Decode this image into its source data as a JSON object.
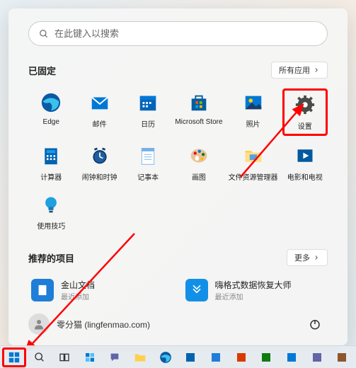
{
  "search": {
    "placeholder": "在此键入以搜索"
  },
  "pinned": {
    "title": "已固定",
    "all_btn": "所有应用",
    "apps": [
      {
        "label": "Edge"
      },
      {
        "label": "邮件"
      },
      {
        "label": "日历"
      },
      {
        "label": "Microsoft Store"
      },
      {
        "label": "照片"
      },
      {
        "label": "设置"
      },
      {
        "label": "计算器"
      },
      {
        "label": "闹钟和时钟"
      },
      {
        "label": "记事本"
      },
      {
        "label": "画图"
      },
      {
        "label": "文件资源管理器"
      },
      {
        "label": "电影和电视"
      },
      {
        "label": "使用技巧"
      }
    ]
  },
  "recommended": {
    "title": "推荐的项目",
    "more_btn": "更多",
    "items": [
      {
        "title": "金山文档",
        "subtitle": "最近添加"
      },
      {
        "title": "嗨格式数据恢复大师",
        "subtitle": "最近添加"
      }
    ]
  },
  "user": {
    "display": "零分猫 (lingfenmao.com)"
  }
}
